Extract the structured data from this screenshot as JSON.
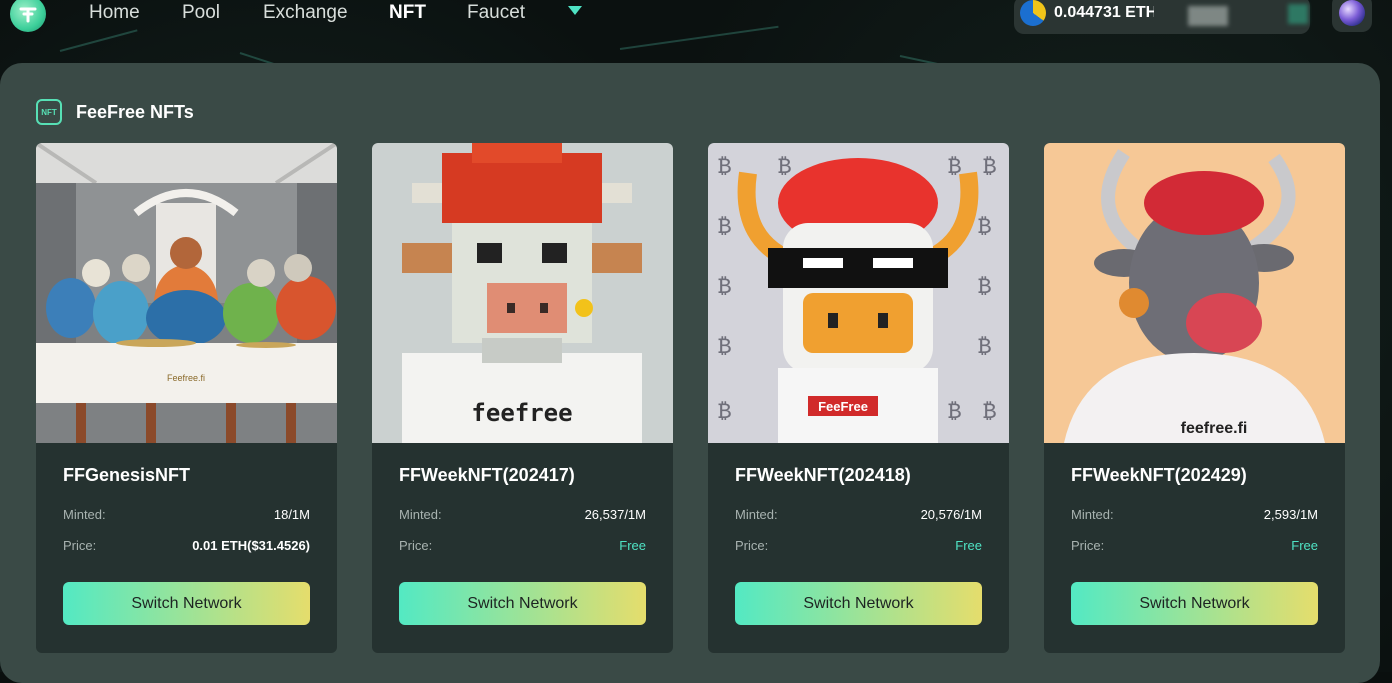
{
  "nav": {
    "links": [
      "Home",
      "Pool",
      "Exchange",
      "NFT",
      "Faucet"
    ],
    "active": "NFT",
    "balance": "0.044731 ETH"
  },
  "section": {
    "badge": "NFT",
    "title": "FeeFree NFTs"
  },
  "cards": [
    {
      "title": "FFGenesisNFT",
      "minted_label": "Minted:",
      "minted": "18/1M",
      "price_label": "Price:",
      "price": "0.01 ETH($31.4526)",
      "button": "Switch Network",
      "shirt_text": "Feefree.fi"
    },
    {
      "title": "FFWeekNFT(202417)",
      "minted_label": "Minted:",
      "minted": "26,537/1M",
      "price_label": "Price:",
      "price": "Free",
      "button": "Switch Network",
      "shirt_text": "feefree"
    },
    {
      "title": "FFWeekNFT(202418)",
      "minted_label": "Minted:",
      "minted": "20,576/1M",
      "price_label": "Price:",
      "price": "Free",
      "button": "Switch Network",
      "shirt_text": "FeeFree"
    },
    {
      "title": "FFWeekNFT(202429)",
      "minted_label": "Minted:",
      "minted": "2,593/1M",
      "price_label": "Price:",
      "price": "Free",
      "button": "Switch Network",
      "shirt_text": "feefree.fi"
    }
  ],
  "colors": {
    "accent": "#4fe3c4",
    "button_from": "#53e9c3",
    "button_to": "#e5dd6c",
    "panel": "#3a4a46",
    "card": "#253230"
  },
  "icons": {
    "logo": "feefree-logo-icon",
    "caret": "chevron-down-icon",
    "network": "eth-icon",
    "wallet": "avatar-orb-icon",
    "section": "nft-badge-icon"
  }
}
